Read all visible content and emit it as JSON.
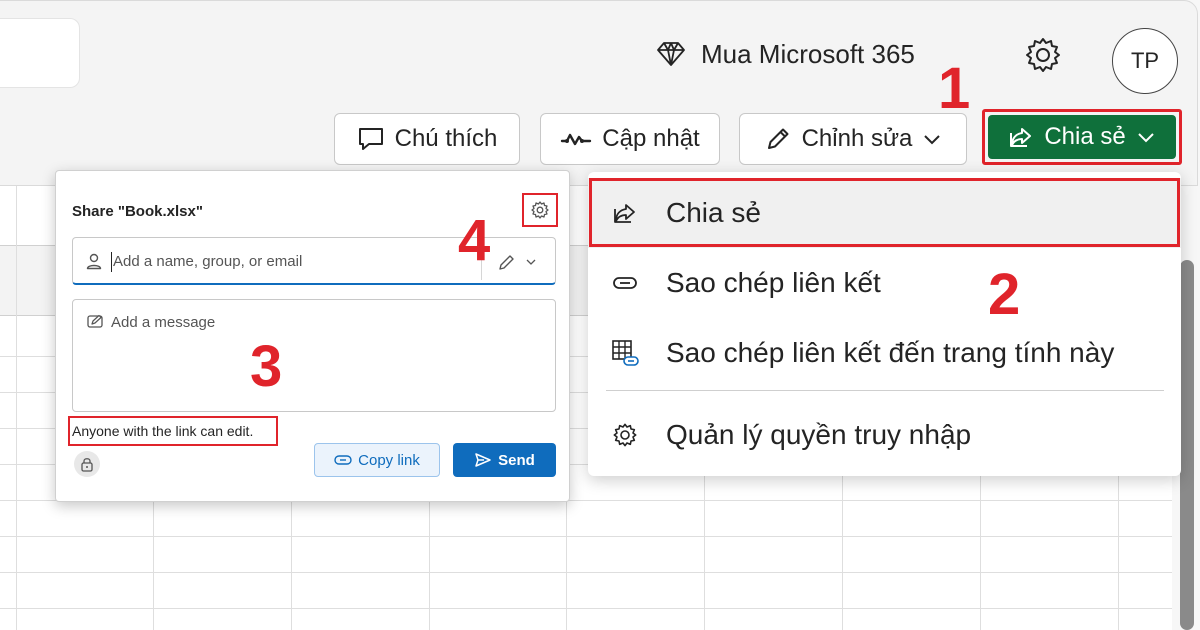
{
  "header": {
    "buy_label": "Mua Microsoft 365",
    "avatar_initials": "TP"
  },
  "toolbar": {
    "comment_label": "Chú thích",
    "update_label": "Cập nhật",
    "edit_label": "Chỉnh sửa",
    "share_label": "Chia sẻ"
  },
  "share_dialog": {
    "title": "Share \"Book.xlsx\"",
    "people_placeholder": "Add a name, group, or email",
    "message_placeholder": "Add a message",
    "link_note": "Anyone with the link can edit.",
    "copy_link_label": "Copy link",
    "send_label": "Send"
  },
  "share_menu": {
    "items": [
      {
        "label": "Chia sẻ",
        "icon": "share-icon"
      },
      {
        "label": "Sao chép liên kết",
        "icon": "link-icon"
      },
      {
        "label": "Sao chép liên kết đến trang tính này",
        "icon": "sheet-link-icon"
      },
      {
        "label": "Quản lý quyền truy nhập",
        "icon": "gear-icon"
      }
    ]
  },
  "steps": [
    "1",
    "2",
    "3",
    "4"
  ],
  "colors": {
    "share_green": "#0f703b",
    "annotation_red": "#e0242b",
    "primary_blue": "#0f6cbd"
  }
}
